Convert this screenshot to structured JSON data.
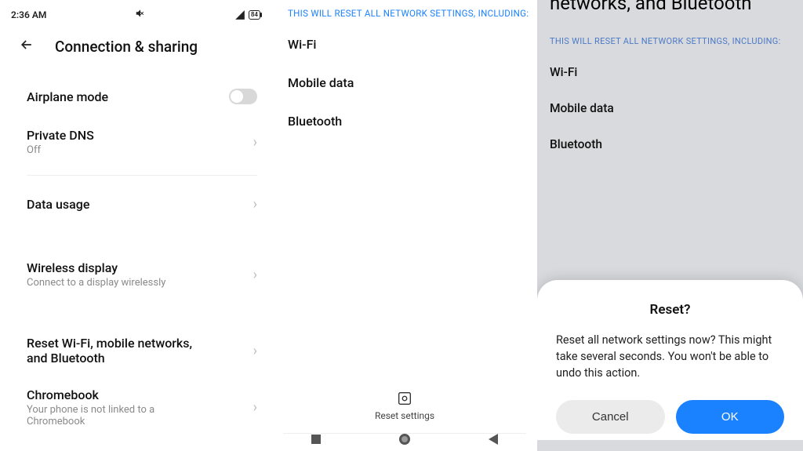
{
  "status": {
    "time": "2:36 AM",
    "battery": "84"
  },
  "panel1": {
    "title": "Connection & sharing",
    "items": [
      {
        "label": "Airplane mode",
        "kind": "toggle"
      },
      {
        "label": "Private DNS",
        "sub": "Off",
        "kind": "link"
      },
      {
        "kind": "divider"
      },
      {
        "label": "Data usage",
        "kind": "link"
      },
      {
        "kind": "biggap"
      },
      {
        "label": "Wireless display",
        "sub": "Connect to a display wirelessly",
        "kind": "link"
      },
      {
        "kind": "biggap"
      },
      {
        "label": "Reset Wi-Fi, mobile networks, and Bluetooth",
        "kind": "link"
      },
      {
        "label": "Chromebook",
        "sub": "Your phone is not linked to a Chromebook",
        "kind": "link"
      }
    ]
  },
  "panel2": {
    "section_title": "THIS WILL RESET ALL NETWORK SETTINGS, INCLUDING:",
    "items": [
      "Wi-Fi",
      "Mobile data",
      "Bluetooth"
    ],
    "reset_label": "Reset settings"
  },
  "panel3": {
    "cutoff_title": "networks, and Bluetooth",
    "section_title": "THIS WILL RESET ALL NETWORK SETTINGS, INCLUDING:",
    "items": [
      "Wi-Fi",
      "Mobile data",
      "Bluetooth"
    ],
    "dialog": {
      "title": "Reset?",
      "body": "Reset all network settings now? This might take several seconds. You won't be able to undo this action.",
      "cancel": "Cancel",
      "ok": "OK"
    }
  }
}
